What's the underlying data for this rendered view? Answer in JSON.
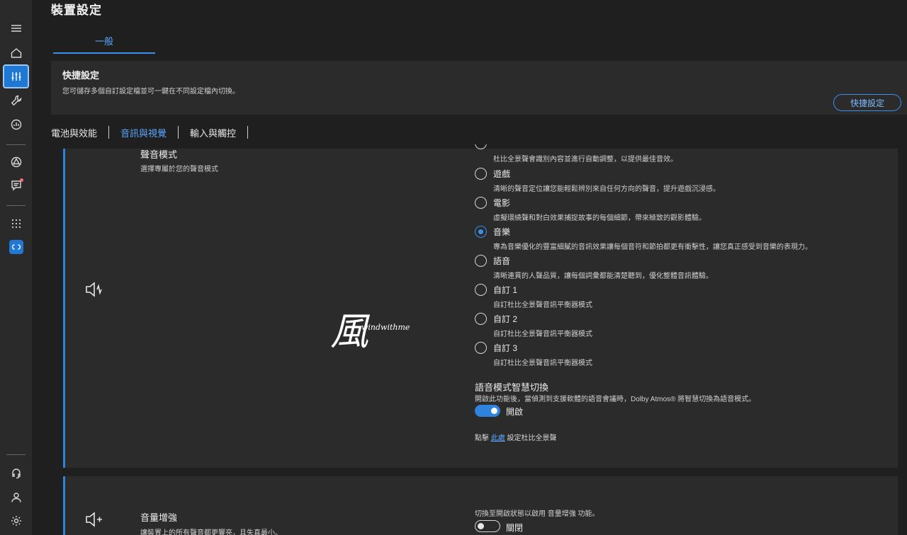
{
  "page": {
    "title": "裝置設定"
  },
  "main_tab": {
    "label": "一般"
  },
  "quick_settings": {
    "title": "快捷設定",
    "description": "您可儲存多個自訂設定檔並可一鍵在不同設定檔內切換。",
    "button": "快捷設定"
  },
  "subnav": [
    "電池與效能",
    "音訊與視覺",
    "輸入與觸控"
  ],
  "sound_mode": {
    "title": "聲音模式",
    "description": "選擇專屬於您的聲音模式",
    "options": [
      {
        "label": "",
        "desc": "杜比全景聲會識別內容並進行自動調整，以提供最佳音效。"
      },
      {
        "label": "遊戲",
        "desc": "清晰的聲音定位讓您能輕鬆辨別來自任何方向的聲音，提升遊戲沉浸感。"
      },
      {
        "label": "電影",
        "desc": "虛擬環繞聲和對白效果捕捉故事的每個細節，帶來極致的觀影體驗。"
      },
      {
        "label": "音樂",
        "desc": "專為音樂優化的豐富細膩的音訊效果讓每個音符和節拍都更有衝擊性，讓您真正感受到音樂的表現力。"
      },
      {
        "label": "語音",
        "desc": "清晰連貫的人聲品質，讓每個詞彙都能清楚聽到，優化整體音訊體驗。"
      },
      {
        "label": "自訂 1",
        "desc": "自訂杜比全景聲音訊平衡器模式"
      },
      {
        "label": "自訂 2",
        "desc": "自訂杜比全景聲音訊平衡器模式"
      },
      {
        "label": "自訂 3",
        "desc": "自訂杜比全景聲音訊平衡器模式"
      }
    ],
    "selected_index": 3,
    "smart_switch": {
      "title": "語音模式智慧切換",
      "description": "開啟此功能後，當偵測到支援軟體的語音會議時，Dolby Atmos® 將智慧切換為語音模式。",
      "state_label": "開啟",
      "enabled": true
    },
    "link": {
      "prefix": "點擊 ",
      "link_text": "此處",
      "suffix": " 設定杜比全景聲"
    }
  },
  "watermark": {
    "char": "風",
    "text": "windwithme"
  },
  "volume_boost": {
    "title": "音量增強",
    "description": "讓裝置上的所有聲音都更響亮，且失真最小。",
    "hint": "切換至開啟狀態以啟用 音量增強 功能。",
    "state_label": "關閉",
    "enabled": false
  },
  "colors": {
    "accent": "#2f83dd",
    "background": "#1f1f1f",
    "card": "#2b2b2b",
    "rail": "#2a2a2a"
  }
}
